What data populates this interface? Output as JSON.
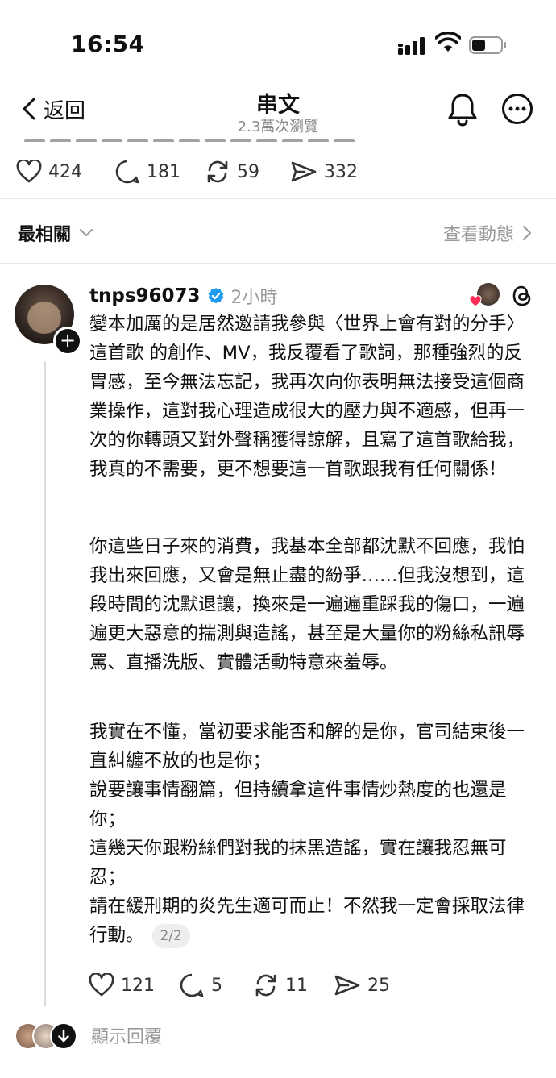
{
  "status_bar": {
    "time": "16:54"
  },
  "nav": {
    "back_label": "返回",
    "title": "串文",
    "subtitle": "2.3萬次瀏覽"
  },
  "top_stats": {
    "likes": "424",
    "replies": "181",
    "reposts": "59",
    "shares": "332"
  },
  "sort": {
    "label": "最相關",
    "activity_label": "查看動態"
  },
  "post": {
    "username": "tnps96073",
    "time_ago": "2小時",
    "paragraphs": [
      "變本加厲的是居然邀請我參與〈世界上會有對的分手〉這首歌 的創作、MV，我反覆看了歌詞，那種強烈的反胃感，至今無法忘記，我再次向你表明無法接受這個商業操作，這對我心理造成很大的壓力與不適感，但再一次的你轉頭又對外聲稱獲得諒解，且寫了這首歌給我，我真的不需要，更不想要這一首歌跟我有任何關係！",
      "你這些日子來的消費，我基本全部都沈默不回應，我怕我出來回應，又會是無止盡的紛爭……但我沒想到，這段時間的沈默退讓，換來是一遍遍重踩我的傷口，一遍遍更大惡意的揣測與造謠，甚至是大量你的粉絲私訊辱罵、直播洗版、實體活動特意來羞辱。",
      "我實在不懂，當初要求能否和解的是你，官司結束後一直糾纏不放的也是你；\n說要讓事情翻篇，但持續拿這件事情炒熱度的也還是你；\n這幾天你跟粉絲們對我的抹黑造謠，實在讓我忍無可忍；\n請在緩刑期的炎先生適可而止！不然我一定會採取法律行動。"
    ],
    "page_indicator": "2/2",
    "stats": {
      "likes": "121",
      "replies": "5",
      "reposts": "11",
      "shares": "25"
    },
    "show_replies_label": "顯示回覆"
  },
  "icons": {
    "like": "heart-icon",
    "reply": "comment-icon",
    "repost": "repost-icon",
    "share": "share-icon",
    "notifications": "bell-icon",
    "more": "more-icon",
    "threads": "threads-logo-icon"
  },
  "colors": {
    "verified": "#1d9bf0",
    "heart_badge": "#ff2d55",
    "muted": "#9a9a9a"
  }
}
